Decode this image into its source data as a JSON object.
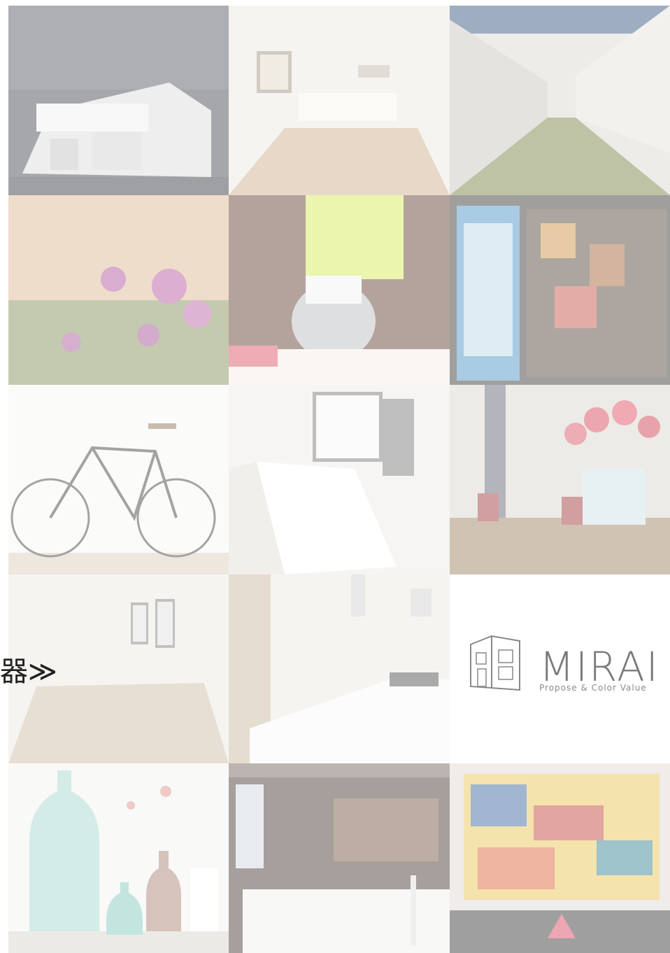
{
  "side_text": "器≫",
  "logo": {
    "wordmark": "MIRAI",
    "tagline": "Propose & Color Value"
  },
  "tiles": [
    "house-night-exterior-photo",
    "bright-room-windows-photo",
    "courtyard-corridor-photo",
    "pink-flowers-photo",
    "stand-mixer-kitchen-photo",
    "cabinet-shelves-photo",
    "bicycle-white-wall-photo",
    "white-kitchen-photo",
    "red-gerbera-dining-photo",
    "empty-room-windows-photo",
    "kitchen-ladder-photo",
    "mirai-logo",
    "glass-bottles-photo",
    "bathroom-photo",
    "abstract-painting-sofa-photo"
  ],
  "colors": {
    "background": "#ffffff",
    "logo_gray": "#7a7a7a"
  }
}
